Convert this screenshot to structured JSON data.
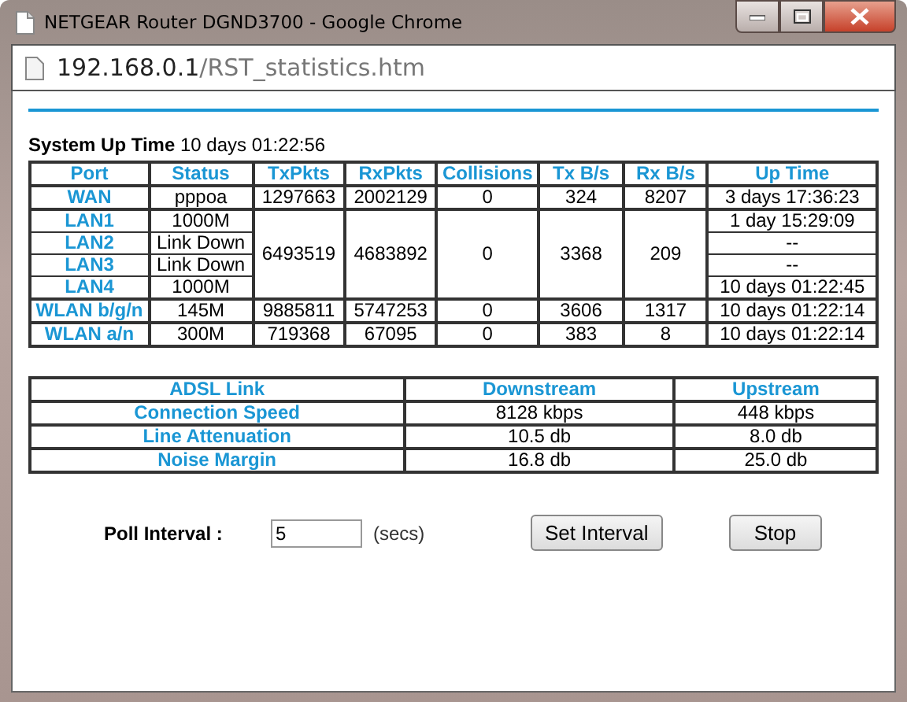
{
  "window": {
    "title": "NETGEAR Router DGND3700 - Google Chrome"
  },
  "address_bar": {
    "host": "192.168.0.1",
    "path": "/RST_statistics.htm"
  },
  "system_up_time": {
    "label": "System Up Time",
    "value": "10 days 01:22:56"
  },
  "port_table": {
    "columns": [
      "Port",
      "Status",
      "TxPkts",
      "RxPkts",
      "Collisions",
      "Tx B/s",
      "Rx B/s",
      "Up Time"
    ],
    "rows": [
      {
        "ports": [
          {
            "port": "WAN",
            "status": "pppoa",
            "up_time": "3 days 17:36:23"
          }
        ],
        "tx_pkts": "1297663",
        "rx_pkts": "2002129",
        "collisions": "0",
        "tx_bs": "324",
        "rx_bs": "8207"
      },
      {
        "ports": [
          {
            "port": "LAN1",
            "status": "1000M",
            "up_time": "1 day 15:29:09"
          },
          {
            "port": "LAN2",
            "status": "Link Down",
            "up_time": "--"
          },
          {
            "port": "LAN3",
            "status": "Link Down",
            "up_time": "--"
          },
          {
            "port": "LAN4",
            "status": "1000M",
            "up_time": "10 days 01:22:45"
          }
        ],
        "tx_pkts": "6493519",
        "rx_pkts": "4683892",
        "collisions": "0",
        "tx_bs": "3368",
        "rx_bs": "209"
      },
      {
        "ports": [
          {
            "port": "WLAN b/g/n",
            "status": "145M",
            "up_time": "10 days 01:22:14"
          }
        ],
        "tx_pkts": "9885811",
        "rx_pkts": "5747253",
        "collisions": "0",
        "tx_bs": "3606",
        "rx_bs": "1317"
      },
      {
        "ports": [
          {
            "port": "WLAN a/n",
            "status": "300M",
            "up_time": "10 days 01:22:14"
          }
        ],
        "tx_pkts": "719368",
        "rx_pkts": "67095",
        "collisions": "0",
        "tx_bs": "383",
        "rx_bs": "8"
      }
    ]
  },
  "adsl_table": {
    "columns": [
      "ADSL Link",
      "Downstream",
      "Upstream"
    ],
    "rows": [
      {
        "label": "Connection Speed",
        "downstream": "8128 kbps",
        "upstream": "448 kbps"
      },
      {
        "label": "Line Attenuation",
        "downstream": "10.5 db",
        "upstream": "8.0 db"
      },
      {
        "label": "Noise Margin",
        "downstream": "16.8 db",
        "upstream": "25.0 db"
      }
    ]
  },
  "poll": {
    "label": "Poll Interval :",
    "value": "5",
    "unit": "(secs)",
    "buttons": [
      "Set Interval",
      "Stop"
    ]
  }
}
